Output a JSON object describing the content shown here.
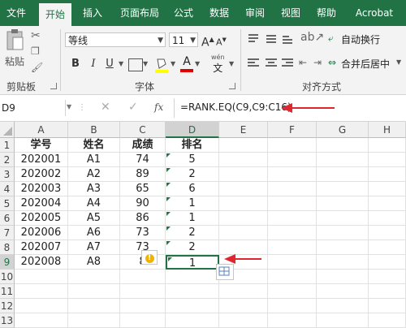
{
  "ribbon_tabs": [
    "文件",
    "开始",
    "插入",
    "页面布局",
    "公式",
    "数据",
    "审阅",
    "视图",
    "帮助",
    "Acrobat"
  ],
  "clipboard": {
    "paste_label": "粘贴",
    "group_label": "剪贴板"
  },
  "font": {
    "name": "等线",
    "size": "11",
    "group_label": "字体",
    "bold": "B",
    "italic": "I",
    "underline": "U",
    "grow": "A",
    "shrink": "A",
    "color_letter": "A",
    "wen": "wén",
    "wen2": "文"
  },
  "alignment": {
    "wrap_label": "自动换行",
    "merge_label": "合并后居中",
    "group_label": "对齐方式"
  },
  "name_box": "D9",
  "fx_label": "fx",
  "formula": "=RANK.EQ(C9,C9:C16)",
  "columns": [
    "A",
    "B",
    "C",
    "D",
    "E",
    "F",
    "G",
    "H"
  ],
  "rows": [
    "1",
    "2",
    "3",
    "4",
    "5",
    "6",
    "7",
    "8",
    "9",
    "10",
    "11",
    "12",
    "13"
  ],
  "headers": [
    "学号",
    "姓名",
    "成绩",
    "排名"
  ],
  "data_rows": [
    [
      "202001",
      "A1",
      "74",
      "5"
    ],
    [
      "202002",
      "A2",
      "89",
      "2"
    ],
    [
      "202003",
      "A3",
      "65",
      "6"
    ],
    [
      "202004",
      "A4",
      "90",
      "1"
    ],
    [
      "202005",
      "A5",
      "86",
      "1"
    ],
    [
      "202006",
      "A6",
      "73",
      "2"
    ],
    [
      "202007",
      "A7",
      "73",
      "2"
    ],
    [
      "202008",
      "A8",
      "8",
      "1"
    ]
  ],
  "accent_color": "#217346",
  "arrow_color": "#e0262f"
}
